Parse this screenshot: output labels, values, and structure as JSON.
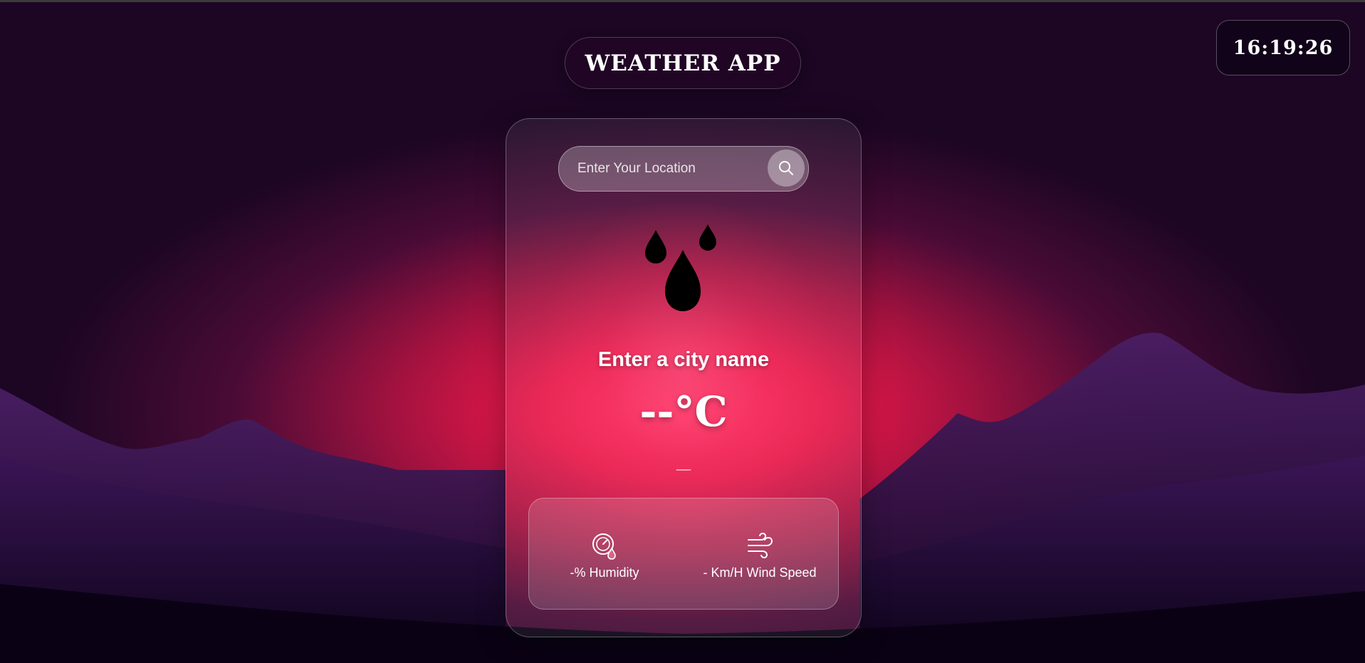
{
  "app": {
    "title": "WEATHER APP",
    "clock": "16:19:26"
  },
  "search": {
    "placeholder": "Enter Your Location",
    "value": "",
    "button_icon": "search-icon"
  },
  "weather": {
    "icon": "rain-drops-icon",
    "city": "Enter a city name",
    "temperature": "--°C",
    "description": "__"
  },
  "details": {
    "humidity": {
      "icon": "humidity-gauge-icon",
      "label": "-% Humidity"
    },
    "wind": {
      "icon": "wind-icon",
      "label": "- Km/H Wind Speed"
    }
  },
  "colors": {
    "accent": "#ff2a5e",
    "sky_dark": "#1c0623",
    "mountain": "#2a0b45",
    "text": "#ffffff"
  }
}
